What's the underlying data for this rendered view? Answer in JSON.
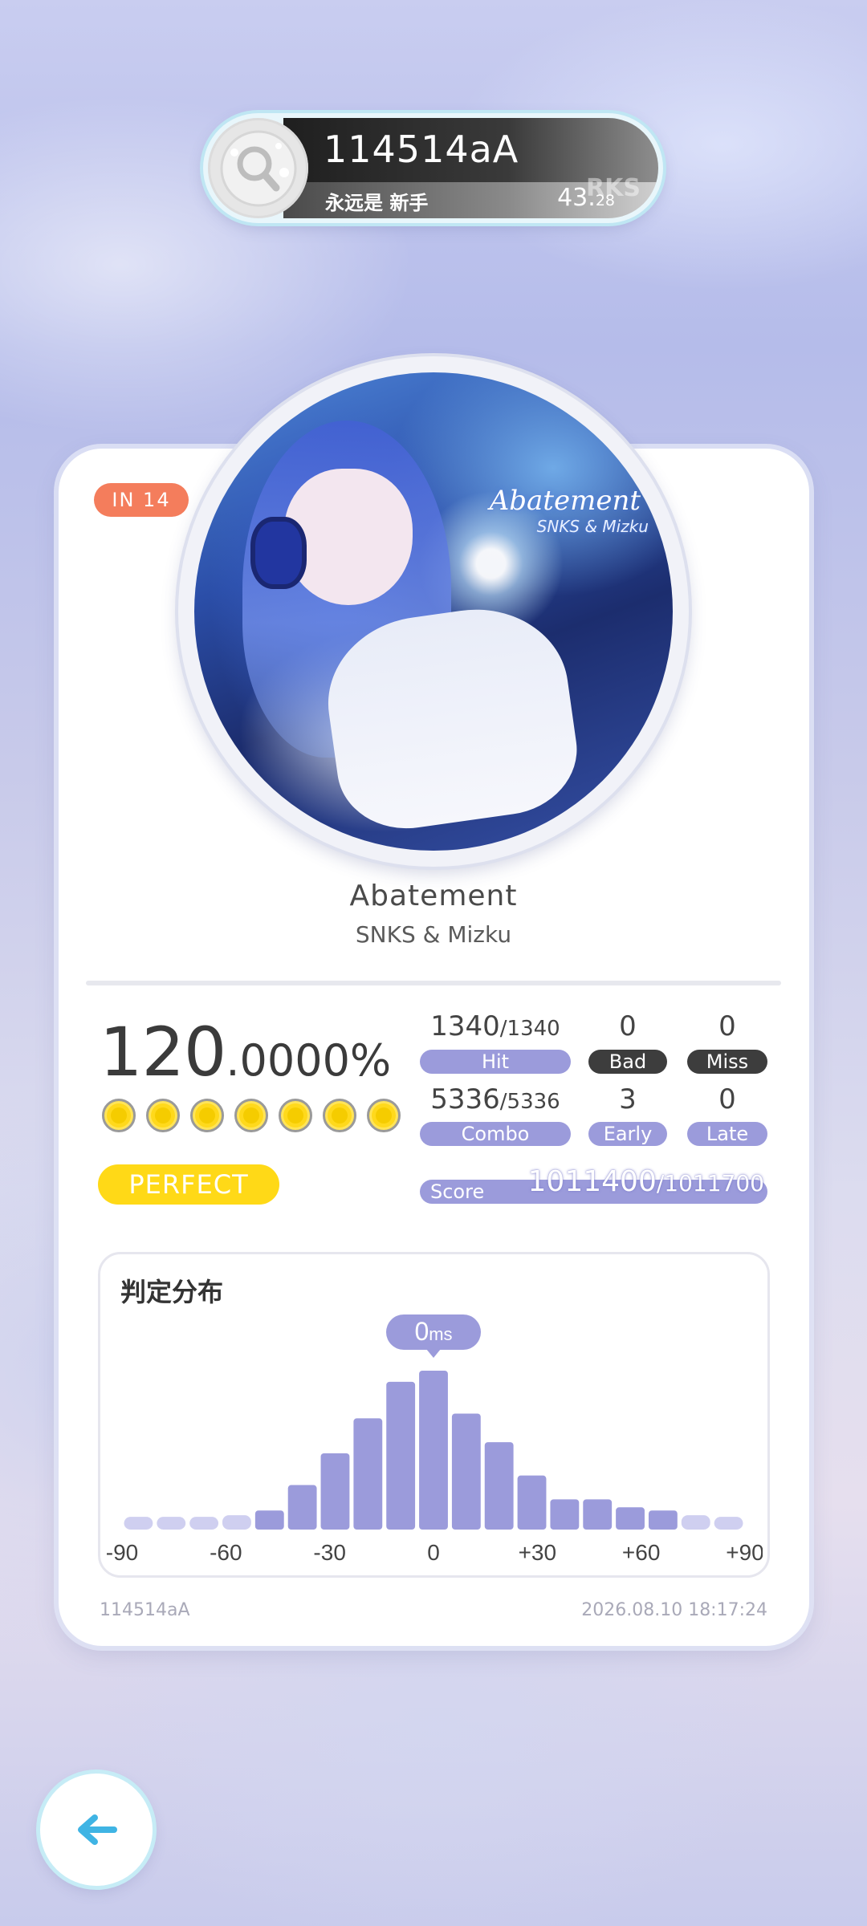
{
  "player": {
    "name": "114514aA",
    "title": "永远是 新手",
    "rks_label": "RKS",
    "rks_int": "43.",
    "rks_dec": "28"
  },
  "song": {
    "difficulty": "IN 14",
    "title": "Abatement",
    "artist": "SNKS & Mizku",
    "cover_title": "Abatement",
    "cover_artist": "SNKS & Mizku"
  },
  "result": {
    "accuracy_int": "120",
    "accuracy_frac": ".0000%",
    "dots_count": 7,
    "grade": "PERFECT"
  },
  "stats": {
    "hit_value": "1340",
    "hit_total": "/1340",
    "hit_label": "Hit",
    "bad_value": "0",
    "bad_label": "Bad",
    "miss_value": "0",
    "miss_label": "Miss",
    "combo_value": "5336",
    "combo_total": "/5336",
    "combo_label": "Combo",
    "early_value": "3",
    "early_label": "Early",
    "late_value": "0",
    "late_label": "Late",
    "score_label": "Score",
    "score_value": "1011400",
    "score_total": "/1011700"
  },
  "distribution": {
    "title": "判定分布",
    "bubble_value": "0",
    "bubble_unit": "ms"
  },
  "chart_data": {
    "type": "bar",
    "x_tick_labels": [
      "-90",
      "-60",
      "-30",
      "0",
      "+30",
      "+60",
      "+90"
    ],
    "xlim": [
      -90,
      90
    ],
    "ylim": [
      0,
      1
    ],
    "values": [
      0.08,
      0.08,
      0.08,
      0.09,
      0.12,
      0.28,
      0.48,
      0.7,
      0.93,
      1.0,
      0.73,
      0.55,
      0.34,
      0.19,
      0.19,
      0.14,
      0.12,
      0.09,
      0.08
    ],
    "highlight": "0ms",
    "colors": {
      "primary": "#9b9bdb",
      "faded": "#cfcff0"
    }
  },
  "footer": {
    "player_name": "114514aA",
    "timestamp": "2026.08.10 18:17:24"
  },
  "colors": {
    "accent": "#9b9bdb",
    "difficulty": "#f47d5c",
    "grade": "#ffd917",
    "dark_pill": "#3d3d3d"
  },
  "icons": {
    "avatar": "magnifier-avatar-icon",
    "back": "arrow-left-icon"
  }
}
